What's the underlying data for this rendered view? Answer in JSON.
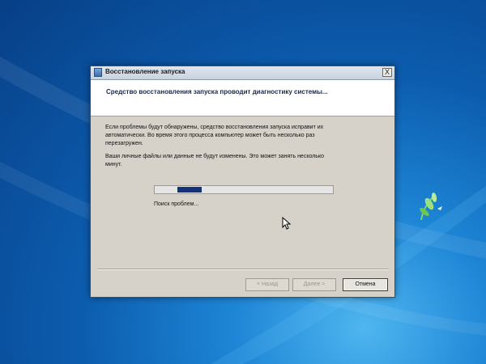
{
  "window": {
    "title": "Восстановление запуска",
    "close_label": "X",
    "header": "Средство восстановления запуска проводит диагностику системы...",
    "paragraph1": "Если проблемы будут обнаружены, средство восстановления запуска исправит их\nавтоматически. Во время этого процесса компьютер может быть несколько раз\nперезагружен.",
    "paragraph2": "Ваши личные файлы или данные не будут изменены. Это может занять несколько\nминут.",
    "progress": {
      "indeterminate": true
    },
    "status": "Поиск проблем...",
    "buttons": {
      "back": "< Назад",
      "next": "Далее >",
      "cancel": "Отмена"
    }
  },
  "colors": {
    "progress_fill": "#14327a",
    "dialog_body": "#d6d2c9"
  }
}
